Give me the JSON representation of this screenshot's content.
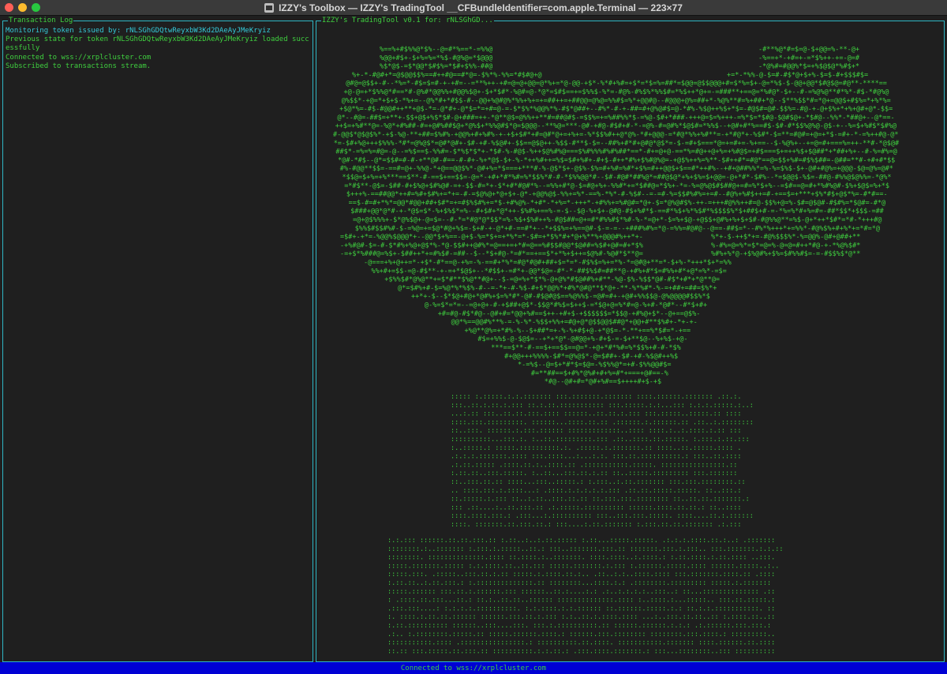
{
  "window": {
    "title": "IZZY's Toolbox — IZZY's TradingTool  __CFBundleIdentifier=com.apple.Terminal — 223×77"
  },
  "transaction_log": {
    "title": "Transaction Log",
    "lines": [
      {
        "text": "Monitoring token issued by: rNLSGhGDQtwReyxbW3Kd2DAeAyJMeKryiz",
        "color": "#35c9d8"
      },
      {
        "text": "Previous state for token rNLSGhGDQtwReyxbW3Kd2DAeAyJMeKryiz loaded successfully",
        "color": "#3fcf3f"
      },
      {
        "text": "Connected to wss://xrplcluster.com",
        "color": "#3fcf3f"
      },
      {
        "text": "Subscribed to transactions stream.",
        "color": "#3fcf3f"
      }
    ]
  },
  "trading_panel": {
    "title": "IZZY's TradingTool v0.1 for: rNLSGhGD..."
  },
  "status_bar": {
    "text": "Connected to wss://xrplcluster.com"
  },
  "colors": {
    "terminal_green": "#3fcf3f",
    "cyan": "#35c9d8",
    "panel_border": "#2fb6c4",
    "status_bar_bg": "#0000d4"
  }
}
